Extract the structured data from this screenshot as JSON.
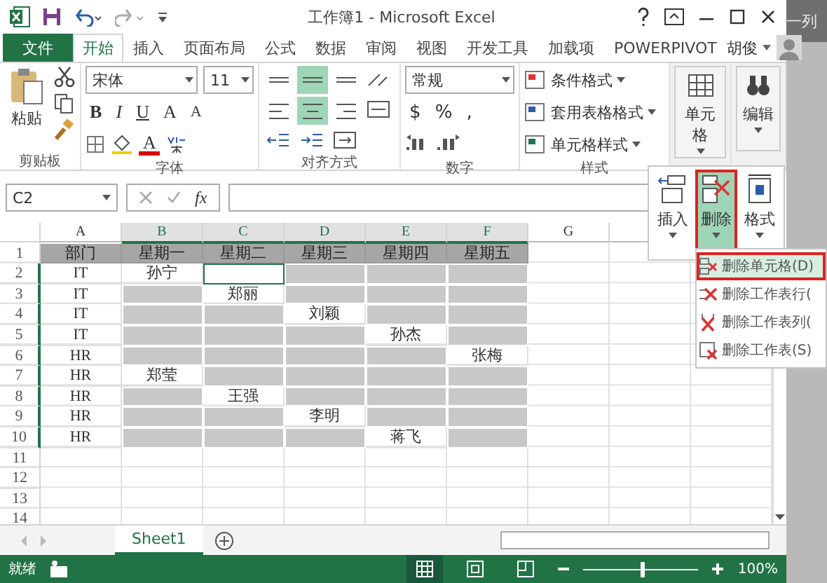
{
  "window": {
    "title": "工作簿1 - Microsoft Excel",
    "user": "胡俊"
  },
  "background_text": "一列",
  "tabs": [
    {
      "label": "文件",
      "kind": "file",
      "selected": false
    },
    {
      "label": "开始",
      "kind": "tab",
      "selected": true
    },
    {
      "label": "插入",
      "kind": "tab",
      "selected": false
    },
    {
      "label": "页面布局",
      "kind": "tab",
      "selected": false
    },
    {
      "label": "公式",
      "kind": "tab",
      "selected": false
    },
    {
      "label": "数据",
      "kind": "tab",
      "selected": false
    },
    {
      "label": "审阅",
      "kind": "tab",
      "selected": false
    },
    {
      "label": "视图",
      "kind": "tab",
      "selected": false
    },
    {
      "label": "开发工具",
      "kind": "tab",
      "selected": false
    },
    {
      "label": "加载项",
      "kind": "tab",
      "selected": false
    },
    {
      "label": "POWERPIVOT",
      "kind": "tab",
      "selected": false
    }
  ],
  "ribbon": {
    "clipboard": {
      "paste": "粘贴",
      "label": "剪贴板"
    },
    "font": {
      "name": "宋体",
      "size": "11",
      "style_buttons": [
        "B",
        "I",
        "U"
      ],
      "grow": "A",
      "shrink": "A",
      "font_color": "A",
      "label": "字体"
    },
    "alignment": {
      "label": "对齐方式",
      "buttons": [
        {
          "kind": "top",
          "selected": false
        },
        {
          "kind": "middle",
          "selected": true
        },
        {
          "kind": "bottom",
          "selected": false
        },
        {
          "kind": "left",
          "selected": false
        },
        {
          "kind": "center",
          "selected": true
        },
        {
          "kind": "right",
          "selected": false
        }
      ]
    },
    "number": {
      "format": "常规",
      "symbols": [
        "$",
        "%",
        ","
      ],
      "label": "数字"
    },
    "styles": {
      "items": [
        "条件格式",
        "套用表格格式",
        "单元格样式"
      ],
      "label": "样式"
    },
    "cells": {
      "label": "单元格"
    },
    "editing": {
      "label": "编辑"
    }
  },
  "formula_bar": {
    "name_box": "C2",
    "fx": "fx"
  },
  "sheet": {
    "columns": [
      {
        "label": "A",
        "selected": false
      },
      {
        "label": "B",
        "selected": true
      },
      {
        "label": "C",
        "selected": true
      },
      {
        "label": "D",
        "selected": true
      },
      {
        "label": "E",
        "selected": true
      },
      {
        "label": "F",
        "selected": true
      },
      {
        "label": "G",
        "selected": false
      }
    ],
    "rows": [
      {
        "number": "1",
        "kind": "header",
        "cells": [
          {
            "text": "部门"
          },
          {
            "text": "星期一"
          },
          {
            "text": "星期二"
          },
          {
            "text": "星期三"
          },
          {
            "text": "星期四"
          },
          {
            "text": "星期五"
          }
        ]
      },
      {
        "number": "2",
        "kind": "data",
        "cells": [
          {
            "text": "IT",
            "shaded": false
          },
          {
            "text": "孙宁",
            "shaded": false
          },
          {
            "shaded": false,
            "active": true
          },
          {
            "shaded": true
          },
          {
            "shaded": true
          },
          {
            "shaded": true
          }
        ]
      },
      {
        "number": "3",
        "kind": "data",
        "cells": [
          {
            "text": "IT",
            "shaded": false
          },
          {
            "shaded": true
          },
          {
            "text": "郑丽",
            "shaded": false
          },
          {
            "shaded": true
          },
          {
            "shaded": true
          },
          {
            "shaded": true
          }
        ]
      },
      {
        "number": "4",
        "kind": "data",
        "cells": [
          {
            "text": "IT",
            "shaded": false
          },
          {
            "shaded": true
          },
          {
            "shaded": true
          },
          {
            "text": "刘颖",
            "shaded": false
          },
          {
            "shaded": true
          },
          {
            "shaded": true
          }
        ]
      },
      {
        "number": "5",
        "kind": "data",
        "cells": [
          {
            "text": "IT",
            "shaded": false
          },
          {
            "shaded": true
          },
          {
            "shaded": true
          },
          {
            "shaded": true
          },
          {
            "text": "孙杰",
            "shaded": false
          },
          {
            "shaded": true
          }
        ]
      },
      {
        "number": "6",
        "kind": "data",
        "cells": [
          {
            "text": "HR",
            "shaded": false
          },
          {
            "shaded": true
          },
          {
            "shaded": true
          },
          {
            "shaded": true
          },
          {
            "shaded": true
          },
          {
            "text": "张梅",
            "shaded": false
          }
        ]
      },
      {
        "number": "7",
        "kind": "data",
        "cells": [
          {
            "text": "HR",
            "shaded": false
          },
          {
            "text": "郑莹",
            "shaded": false
          },
          {
            "shaded": true
          },
          {
            "shaded": true
          },
          {
            "shaded": true
          },
          {
            "shaded": true
          }
        ]
      },
      {
        "number": "8",
        "kind": "data",
        "cells": [
          {
            "text": "HR",
            "shaded": false
          },
          {
            "shaded": true
          },
          {
            "text": "王强",
            "shaded": false
          },
          {
            "shaded": true
          },
          {
            "shaded": true
          },
          {
            "shaded": true
          }
        ]
      },
      {
        "number": "9",
        "kind": "data",
        "cells": [
          {
            "text": "HR",
            "shaded": false
          },
          {
            "shaded": true
          },
          {
            "shaded": true
          },
          {
            "text": "李明",
            "shaded": false
          },
          {
            "shaded": true
          },
          {
            "shaded": true
          }
        ]
      },
      {
        "number": "10",
        "kind": "data",
        "cells": [
          {
            "text": "HR",
            "shaded": false
          },
          {
            "shaded": true
          },
          {
            "shaded": true
          },
          {
            "shaded": true
          },
          {
            "text": "蒋飞",
            "shaded": false
          },
          {
            "shaded": true
          }
        ]
      },
      {
        "number": "11",
        "kind": "empty"
      },
      {
        "number": "12",
        "kind": "empty"
      },
      {
        "number": "13",
        "kind": "empty"
      },
      {
        "number": "14",
        "kind": "empty"
      }
    ]
  },
  "cell_menu": {
    "buttons": [
      {
        "label": "插入",
        "kind": "insert",
        "selected": false
      },
      {
        "label": "删除",
        "kind": "delete",
        "selected": true
      },
      {
        "label": "格式",
        "kind": "format",
        "selected": false
      }
    ],
    "items": [
      {
        "label": "删除单元格(D)",
        "kind": "cells",
        "selected": true
      },
      {
        "label": "删除工作表行(",
        "kind": "row",
        "selected": false
      },
      {
        "label": "删除工作表列(",
        "kind": "column",
        "selected": false
      },
      {
        "label": "删除工作表(S)",
        "kind": "sheet",
        "selected": false
      }
    ]
  },
  "sheet_tabs": [
    {
      "label": "Sheet1",
      "selected": true
    }
  ],
  "status_bar": {
    "text": "就绪",
    "views": [
      {
        "kind": "normal",
        "selected": true
      },
      {
        "kind": "layout",
        "selected": false
      },
      {
        "kind": "break",
        "selected": false
      }
    ],
    "zoom": {
      "level": 0.5,
      "reading": "100%"
    }
  }
}
